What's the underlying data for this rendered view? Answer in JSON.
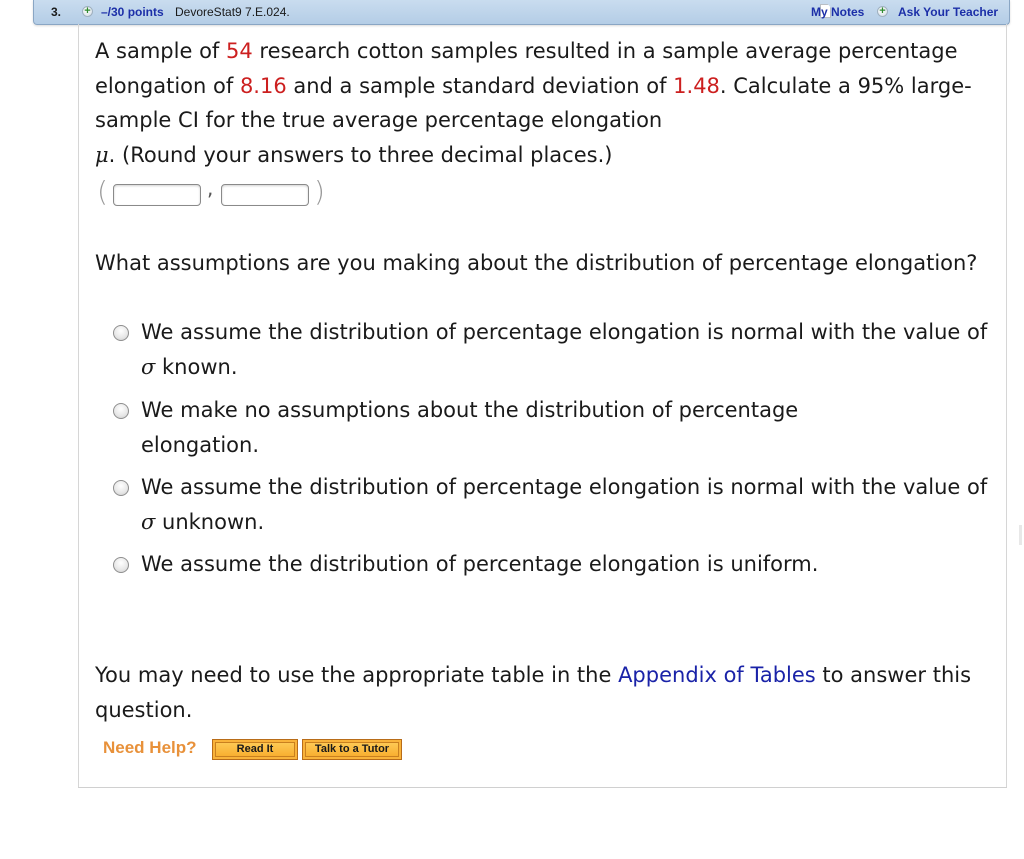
{
  "header": {
    "question_number": "3.",
    "points": "–/30 points",
    "source": "DevoreStat9 7.E.024.",
    "my_notes": "My Notes",
    "ask_teacher": "Ask Your Teacher"
  },
  "question": {
    "part1": "A sample of ",
    "n": "54",
    "part2": " research cotton samples resulted in a sample average percentage elongation of ",
    "mean": "8.16",
    "part3": " and a sample standard deviation of ",
    "sd": "1.48",
    "part4": ". Calculate a 95% large-sample CI for the true average percentage elongation ",
    "mu": "μ",
    "part5": ". (Round your answers to three decimal places.)"
  },
  "answer": {
    "open_paren": "(",
    "comma": ",",
    "close_paren": ")",
    "lower_value": "",
    "upper_value": ""
  },
  "assumption_question": "What assumptions are you making about the distribution of percentage elongation?",
  "options": [
    {
      "text_a": "We assume the distribution of percentage elongation is normal with the value of ",
      "sigma": "σ",
      "text_b": " known.",
      "selected": false
    },
    {
      "text_a": "We make no assumptions about the distribution of percentage elongation.",
      "sigma": "",
      "text_b": "",
      "selected": false
    },
    {
      "text_a": "We assume the distribution of percentage elongation is normal with the value of ",
      "sigma": "σ",
      "text_b": " unknown.",
      "selected": false
    },
    {
      "text_a": "We assume the distribution of percentage elongation is uniform.",
      "sigma": "",
      "text_b": "",
      "selected": false
    }
  ],
  "appendix": {
    "before": "You may need to use the appropriate table in the ",
    "link": "Appendix of Tables",
    "after": " to answer this question."
  },
  "help": {
    "label": "Need Help?",
    "read_it": "Read It",
    "talk_tutor": "Talk to a Tutor"
  },
  "colors": {
    "highlight_red": "#cc1f1f",
    "link_blue": "#1a23a8",
    "help_orange": "#e8913a",
    "header_bg": "#bcd3ea"
  }
}
